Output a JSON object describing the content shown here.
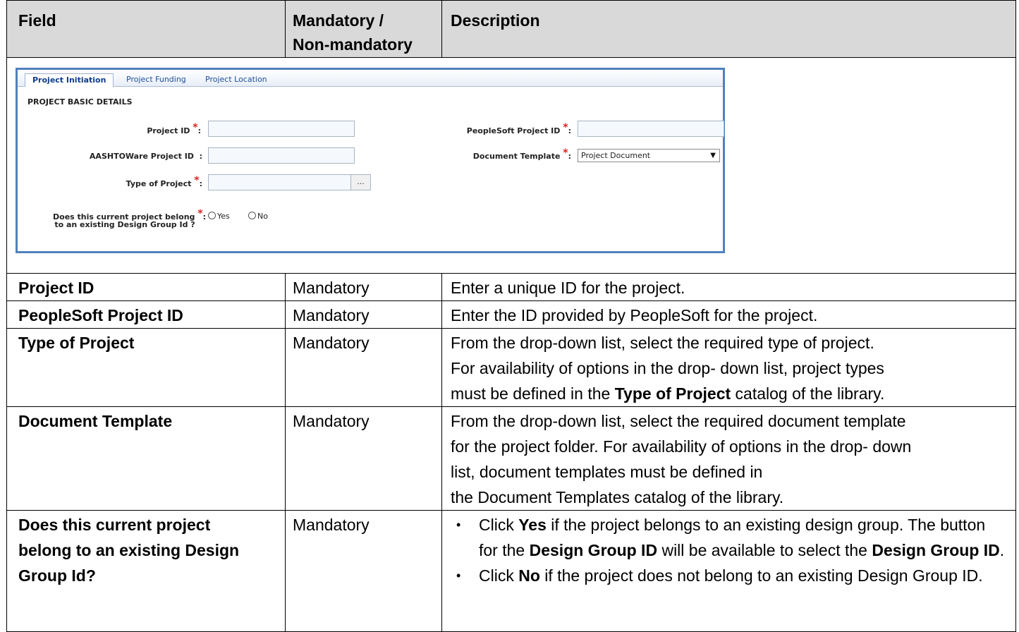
{
  "header": {
    "field": "Field",
    "mandatory_line1": "Mandatory /",
    "mandatory_line2": "Non-mandatory",
    "description": "Description"
  },
  "screenshot": {
    "tabs": [
      "Project Initiation",
      "Project Funding",
      "Project Location"
    ],
    "section_title": "PROJECT BASIC DETAILS",
    "labels": {
      "project_id": "Project ID",
      "aashtoware_project_id": "AASHTOWare Project ID",
      "type_of_project": "Type of Project",
      "peoplesoft_project_id": "PeopleSoft Project ID",
      "document_template": "Document Template",
      "design_group_q1": "Does this current project belong",
      "design_group_q2": "to an existing Design Group Id ?"
    },
    "required_mark": "*",
    "colon": ":",
    "ellipsis": "...",
    "document_template_value": "Project Document",
    "dropdown_arrow": "▼",
    "radio_yes": "Yes",
    "radio_no": "No",
    "accent_color": "#4f81bd",
    "required_color": "#e02020"
  },
  "rows": [
    {
      "field": "Project ID",
      "mandatory": "Mandatory",
      "description": [
        "Enter a unique ID for the project."
      ]
    },
    {
      "field": "PeopleSoft Project ID",
      "mandatory": "Mandatory",
      "description": [
        "Enter the ID provided by PeopleSoft for the project."
      ]
    },
    {
      "field": "Type of Project",
      "mandatory": "Mandatory",
      "description_line1": "From the drop-down list, select the required type of project.",
      "description_line2": "For availability of options in the drop- down list, project types",
      "description_line3_pre": "must be defined in the ",
      "description_line3_bold": "Type of Project",
      "description_line3_post": " catalog of the library."
    },
    {
      "field": "Document Template",
      "mandatory": "Mandatory",
      "description_line1": "From the drop-down list, select the required document template",
      "description_line2": "for the project folder. For availability of options in the drop- down",
      "description_line3": "list, document templates must be defined in",
      "description_line4": "the Document Templates catalog of the library."
    },
    {
      "field_line1": "Does this current project",
      "field_line2": "belong to an existing Design",
      "field_line3": "Group Id?",
      "mandatory": "Mandatory",
      "bullet1_pre": "Click ",
      "bullet1_bold": "Yes",
      "bullet1_mid": " if the project belongs to an existing design group. The button for the ",
      "bullet1_bold2": "Design Group ID",
      "bullet1_mid2": " will be available to select the ",
      "bullet1_bold3": "Design Group ID",
      "bullet1_end": ".",
      "bullet2_pre": "Click ",
      "bullet2_bold": "No",
      "bullet2_post": " if the project does not belong to an existing Design Group ID."
    }
  ]
}
